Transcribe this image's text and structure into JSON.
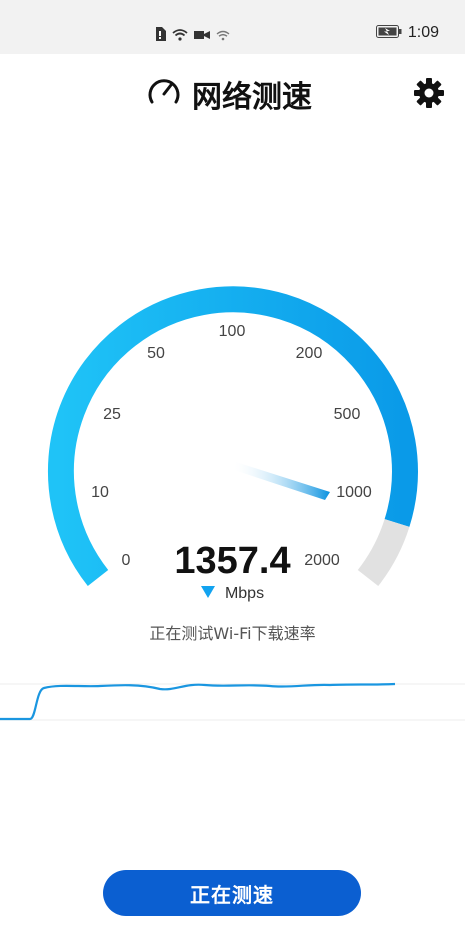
{
  "status_bar": {
    "time": "1:09",
    "icons": [
      "sim-alert-icon",
      "wifi-icon",
      "video-icon",
      "wifi-icon",
      "battery-icon"
    ]
  },
  "header": {
    "title": "网络测速",
    "title_icon": "speedometer-icon",
    "settings_icon": "gear-icon"
  },
  "gauge": {
    "labels": [
      "0",
      "10",
      "25",
      "50",
      "100",
      "200",
      "500",
      "1000",
      "2000"
    ],
    "reading": "1357.4",
    "unit": "Mbps",
    "direction_icon": "download-arrow-icon"
  },
  "status_text": "正在测试Wi-Fi下载速率",
  "action_button": {
    "label": "正在测速"
  },
  "colors": {
    "accent": "#12a3f0",
    "button": "#0b5fd1",
    "track": "#e1e1e1"
  }
}
